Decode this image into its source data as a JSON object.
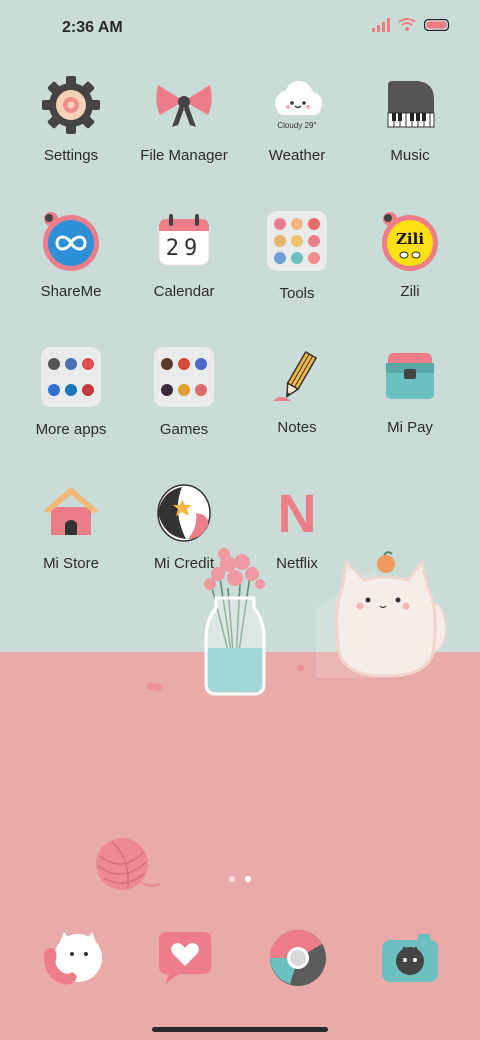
{
  "status_bar": {
    "time": "2:36 AM"
  },
  "apps": [
    {
      "label": "Settings",
      "icon": "gear-icon"
    },
    {
      "label": "File Manager",
      "icon": "bow-icon"
    },
    {
      "label": "Weather",
      "icon": "cloud-icon",
      "detail": "Cloudy 29°"
    },
    {
      "label": "Music",
      "icon": "piano-icon"
    },
    {
      "label": "ShareMe",
      "icon": "infinity-icon"
    },
    {
      "label": "Calendar",
      "icon": "calendar-icon",
      "detail": "29"
    },
    {
      "label": "Tools",
      "icon": "tools-folder-icon"
    },
    {
      "label": "Zili",
      "icon": "zili-icon",
      "detail": "Zili"
    },
    {
      "label": "More apps",
      "icon": "folder-icon"
    },
    {
      "label": "Games",
      "icon": "folder-icon"
    },
    {
      "label": "Notes",
      "icon": "pencil-icon"
    },
    {
      "label": "Mi Pay",
      "icon": "wallet-icon"
    },
    {
      "label": "Mi Store",
      "icon": "house-icon"
    },
    {
      "label": "Mi Credit",
      "icon": "egg-icon"
    },
    {
      "label": "Netflix",
      "icon": "netflix-icon",
      "detail": "N"
    }
  ],
  "page_indicator": {
    "count": 2,
    "active": 2
  },
  "dock": [
    {
      "icon": "cat-phone-icon"
    },
    {
      "icon": "heart-message-icon"
    },
    {
      "icon": "browser-icon"
    },
    {
      "icon": "camera-icon"
    }
  ],
  "colors": {
    "wall": "#c9dcd8",
    "floor": "#e9aaaa",
    "accent_pink": "#ee7d8a",
    "accent_teal": "#6cc0bf"
  }
}
